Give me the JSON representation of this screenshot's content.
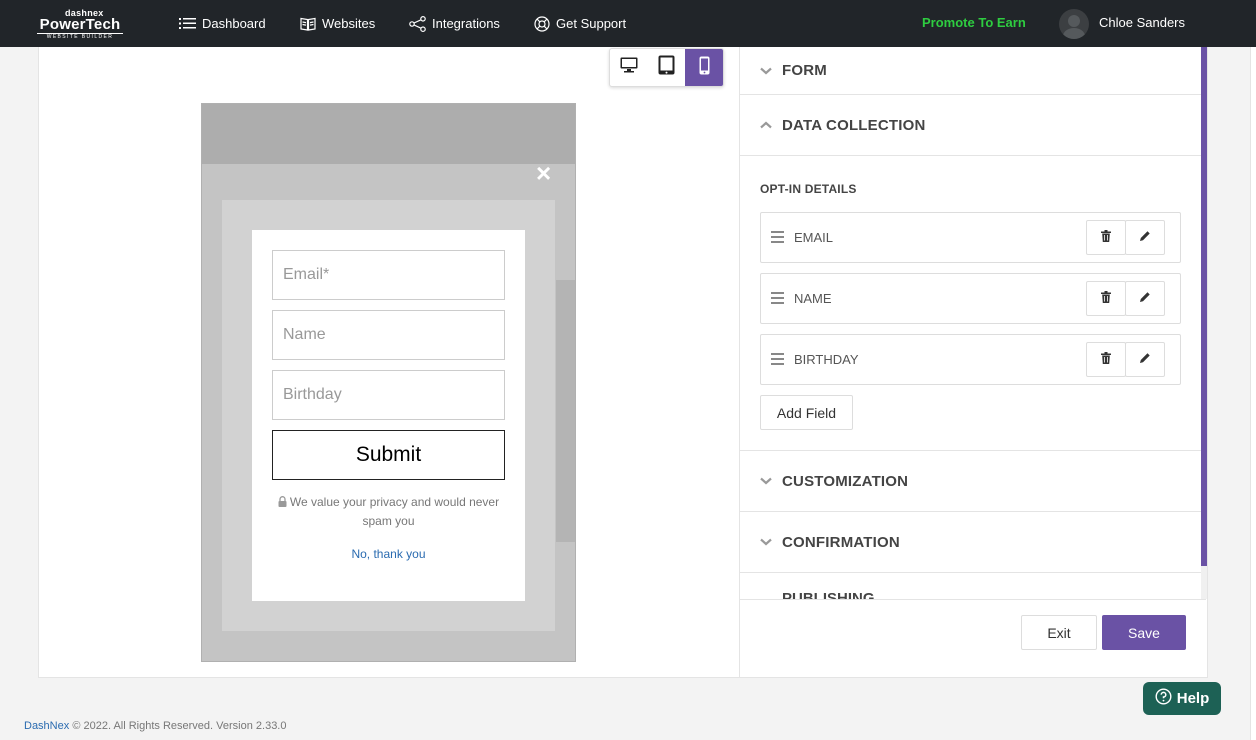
{
  "brand": {
    "line1": "dashnex",
    "line2": "PowerTech",
    "line3": "WEBSITE BUILDER"
  },
  "nav": {
    "items": [
      {
        "label": "Dashboard",
        "icon": "list-icon"
      },
      {
        "label": "Websites",
        "icon": "book-icon"
      },
      {
        "label": "Integrations",
        "icon": "share-icon"
      },
      {
        "label": "Get Support",
        "icon": "lifebuoy-icon"
      }
    ],
    "promote": "Promote To Earn",
    "user": "Chloe Sanders"
  },
  "colors": {
    "accent": "#6a52a5",
    "promote": "#2ecc40",
    "help": "#1d6155",
    "link": "#2a6bb0"
  },
  "device_toggle": {
    "options": [
      "desktop",
      "tablet",
      "mobile"
    ],
    "selected": "mobile"
  },
  "preview": {
    "close": "×",
    "fields": [
      "Email*",
      "Name",
      "Birthday"
    ],
    "submit": "Submit",
    "privacy": "We value your privacy and would never spam you",
    "decline": "No, thank you"
  },
  "panel": {
    "sections": {
      "form": "FORM",
      "data_collection": "DATA COLLECTION",
      "customization": "CUSTOMIZATION",
      "confirmation": "CONFIRMATION",
      "publishing": "PUBLISHING"
    },
    "optin_title": "OPT-IN DETAILS",
    "optin_fields": [
      "EMAIL",
      "NAME",
      "BIRTHDAY"
    ],
    "add_field": "Add Field",
    "exit": "Exit",
    "save": "Save"
  },
  "help": "Help",
  "footer": {
    "brand": "DashNex",
    "text": "© 2022. All Rights Reserved. Version 2.33.0"
  }
}
